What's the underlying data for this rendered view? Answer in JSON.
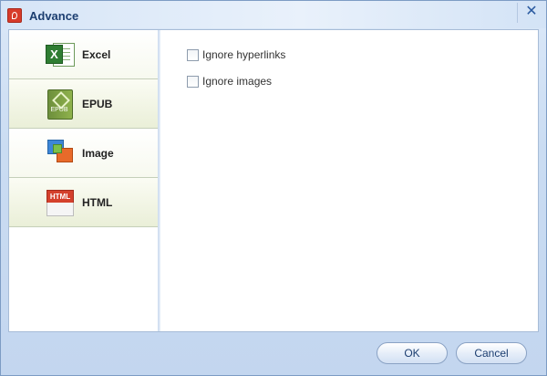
{
  "window": {
    "title": "Advance",
    "close_glyph": "✕",
    "app_icon": "pdf-app-icon"
  },
  "sidebar": {
    "items": [
      {
        "label": "Excel",
        "icon": "excel-icon"
      },
      {
        "label": "EPUB",
        "icon": "epub-icon"
      },
      {
        "label": "Image",
        "icon": "image-icon"
      },
      {
        "label": "HTML",
        "icon": "html-icon"
      }
    ]
  },
  "icons": {
    "excel_letter": "X",
    "epub_text": "EPUB",
    "html_text": "HTML"
  },
  "options": [
    {
      "label": "Ignore hyperlinks",
      "checked": false
    },
    {
      "label": "Ignore images",
      "checked": false
    }
  ],
  "buttons": {
    "ok": "OK",
    "cancel": "Cancel"
  },
  "colors": {
    "title_text": "#1c3e70",
    "accent": "#2a5aa0"
  }
}
